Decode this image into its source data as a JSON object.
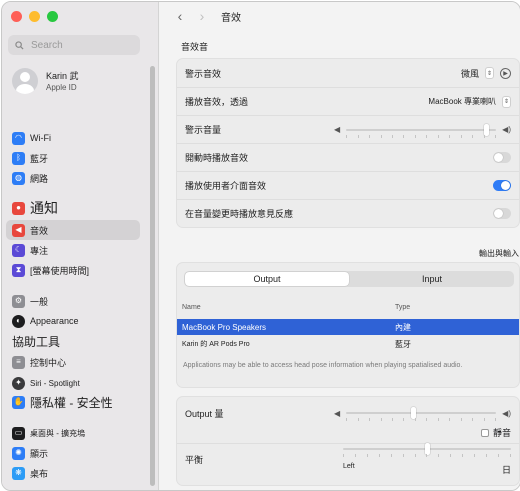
{
  "window": {
    "controls": [
      "close",
      "minimize",
      "zoom"
    ]
  },
  "sidebar": {
    "search_placeholder": "Search",
    "account": {
      "name": "Karin 武",
      "subtitle": "Apple ID"
    },
    "items": [
      {
        "label": "Wi-Fi",
        "icon": "wifi-icon",
        "color": "#2d7df6"
      },
      {
        "label": "藍牙",
        "icon": "bluetooth-icon",
        "color": "#2d7df6"
      },
      {
        "label": "網路",
        "icon": "globe-icon",
        "color": "#2d7df6"
      },
      {
        "label": "通知",
        "icon": "bell-icon",
        "color": "#e8473d"
      },
      {
        "label": "音效",
        "icon": "speaker-icon",
        "color": "#e8473d"
      },
      {
        "label": "專注",
        "icon": "moon-icon",
        "color": "#5b4ad6"
      },
      {
        "label": "[螢幕使用時間]",
        "icon": "hourglass-icon",
        "color": "#5b4ad6"
      },
      {
        "label": "一般",
        "icon": "gear-icon",
        "color": "#8e8e93"
      },
      {
        "label": "Appearance",
        "icon": "appearance-icon",
        "color": "#1d1d1f"
      },
      {
        "label": "協助工具",
        "icon": "accessibility-icon",
        "color": "#2d7df6"
      },
      {
        "label": "控制中心",
        "icon": "control-center-icon",
        "color": "#8e8e93"
      },
      {
        "label": "Siri - Spotlight",
        "icon": "siri-icon",
        "color": "#3a3a3c"
      },
      {
        "label": "隱私權 - 安全性",
        "icon": "hand-icon",
        "color": "#2d7df6"
      },
      {
        "label": "桌面與 - 擴充塢",
        "icon": "dock-icon",
        "color": "#1d1d1f"
      },
      {
        "label": "顯示",
        "icon": "display-icon",
        "color": "#2d7df6"
      },
      {
        "label": "桌布",
        "icon": "wallpaper-icon",
        "color": "#2d9cf6"
      }
    ]
  },
  "toolbar": {
    "back": "‹",
    "forward": "›",
    "title": "音效"
  },
  "sound_effects": {
    "section_title": "音效音",
    "alert_sound_label": "警示音效",
    "alert_sound_value": "微風",
    "play_through_label": "播放音效，透過",
    "play_through_value": "MacBook 專業喇叭",
    "alert_volume_label": "警示音量",
    "alert_volume_level": 0.95,
    "startup_label": "開動時播放音效",
    "startup_on": false,
    "ui_sounds_label": "播放使用者介面音效",
    "ui_sounds_on": true,
    "feedback_label": "在音量變更時播放意見反應",
    "feedback_on": false
  },
  "output_input": {
    "section_title": "輸出與輸入",
    "tabs": [
      "Output",
      "Input"
    ],
    "selected_tab": "Output",
    "columns": {
      "name": "Name",
      "type": "Type"
    },
    "devices": [
      {
        "name": "MacBook Pro Speakers",
        "type": "內建",
        "selected": true
      },
      {
        "name": "Karin 的 AR Pods Pro",
        "type": "藍牙",
        "selected": false
      }
    ],
    "note": "Applications may be able to access head pose information when playing spatialised audio."
  },
  "output_volume": {
    "label": "Output 量",
    "level": 0.45,
    "mute_label": "靜音",
    "muted": false,
    "balance_label": "平衡",
    "balance_left": "Left",
    "balance_right": "日",
    "balance_level": 0.5
  }
}
